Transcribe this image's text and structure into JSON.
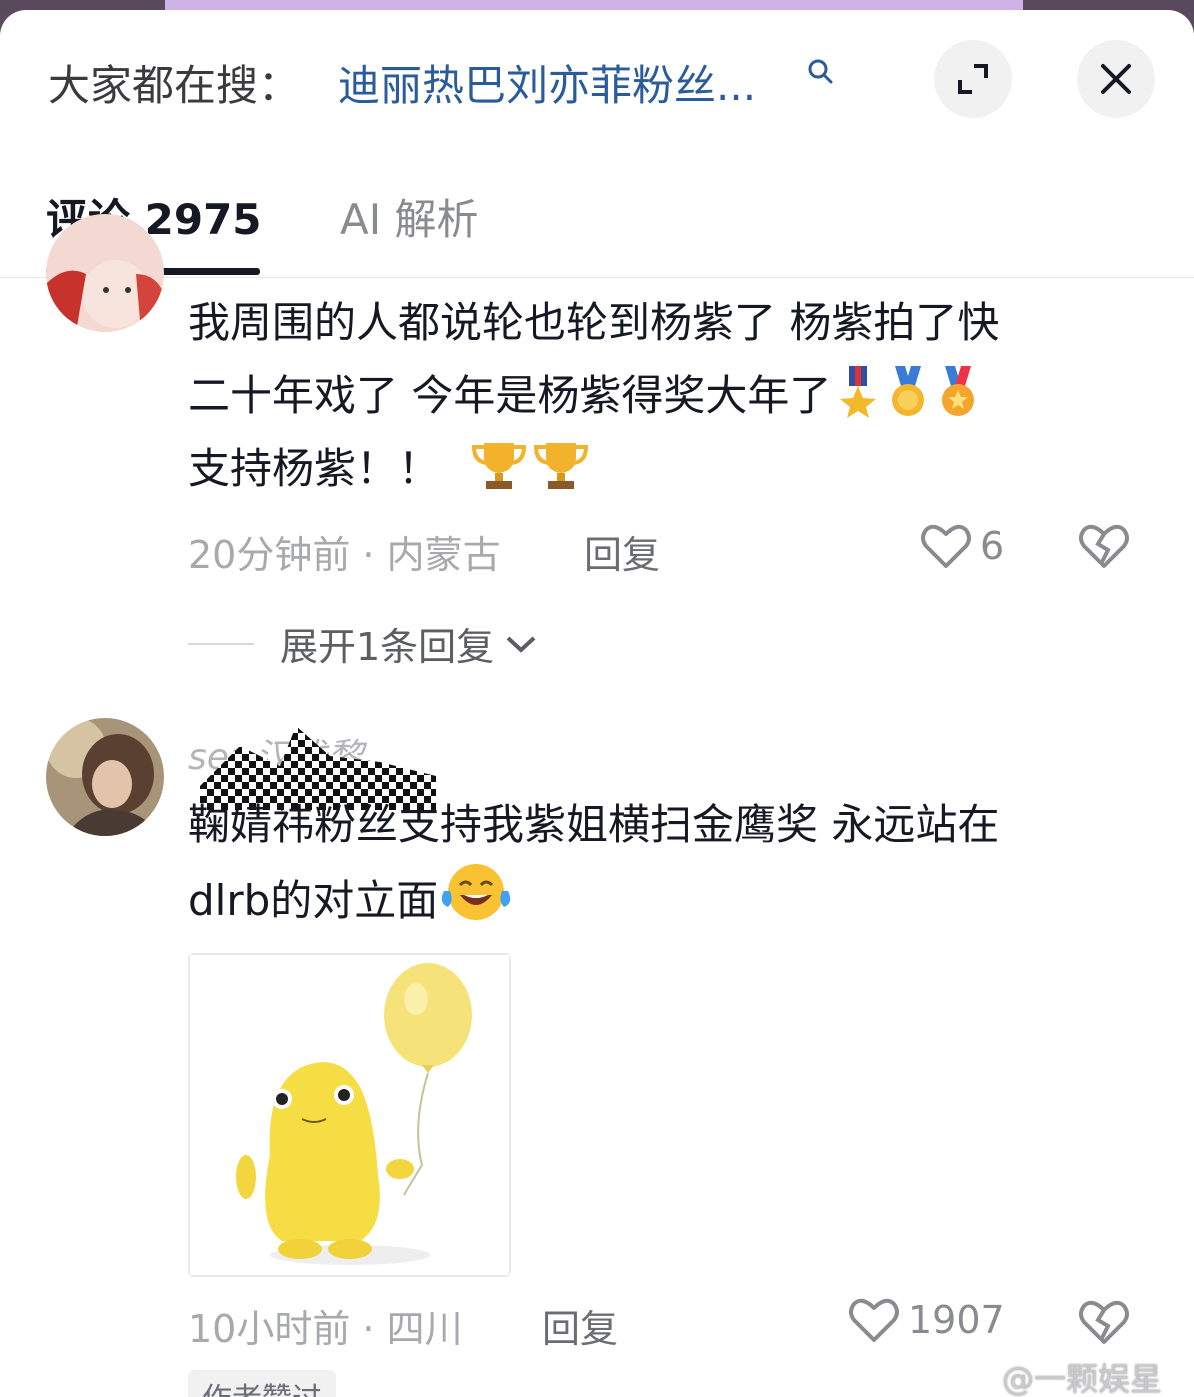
{
  "header": {
    "search_prefix": "大家都在搜：",
    "search_term": "迪丽热巴刘亦菲粉丝...",
    "expand_icon": "expand-icon",
    "close_icon": "close-icon"
  },
  "tabs": [
    {
      "label": "评论 2975",
      "active": true
    },
    {
      "label": "AI 解析",
      "active": false
    }
  ],
  "comments": [
    {
      "lines": [
        "我周围的人都说轮也轮到杨紫了 杨紫拍了快",
        "二十年戏了 今年是杨紫得奖大年了",
        "支持杨紫！！"
      ],
      "emojis_line2": [
        "medal",
        "gold-medal",
        "sports-medal"
      ],
      "emojis_line3": [
        "trophy",
        "trophy"
      ],
      "time_location": "20分钟前 · 内蒙古",
      "reply_label": "回复",
      "likes": "6",
      "expand_replies": "展开1条回复"
    },
    {
      "username": "ser  汉浅黎",
      "lines": [
        "鞠婧祎粉丝支持我紫姐横扫金鹰奖 永远站在",
        "dlrb的对立面"
      ],
      "emojis_line2": [
        "tears-of-joy"
      ],
      "time_location": "10小时前 · 四川",
      "reply_label": "回复",
      "likes": "1907",
      "badge": "作者赞过"
    }
  ],
  "watermark": "@一颗娱星",
  "colors": {
    "link": "#2a5b9a",
    "text": "#161823",
    "muted": "#a8a9ad",
    "icon": "#6c6d73"
  }
}
